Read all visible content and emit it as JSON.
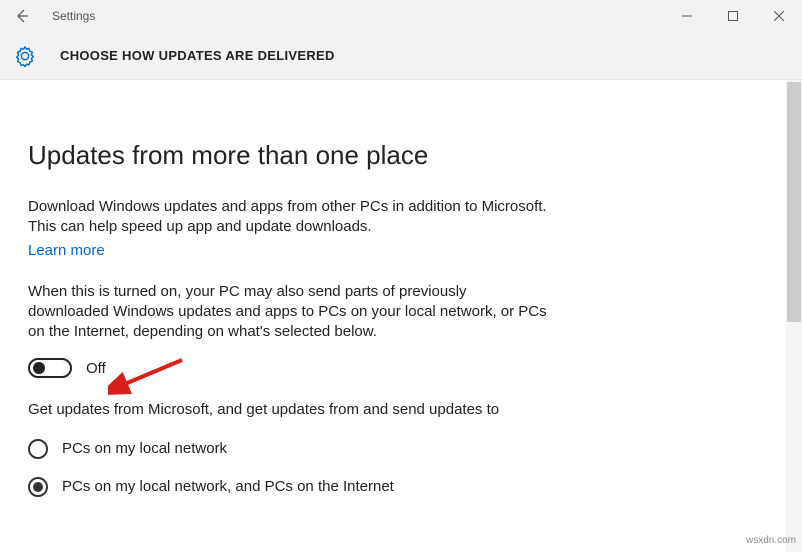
{
  "titlebar": {
    "title": "Settings"
  },
  "header": {
    "title": "CHOOSE HOW UPDATES ARE DELIVERED"
  },
  "main": {
    "heading": "Updates from more than one place",
    "intro": "Download Windows updates and apps from other PCs in addition to Microsoft. This can help speed up app and update downloads.",
    "learn_more": "Learn more",
    "toggle_desc": "When this is turned on, your PC may also send parts of previously downloaded Windows updates and apps to PCs on your local network, or PCs on the Internet, depending on what's selected below.",
    "toggle_state": "Off",
    "radio_intro": "Get updates from Microsoft, and get updates from and send updates to",
    "radio_options": [
      {
        "label": "PCs on my local network",
        "selected": false
      },
      {
        "label": "PCs on my local network, and PCs on the Internet",
        "selected": true
      }
    ]
  },
  "watermark": "wsxdn.com"
}
